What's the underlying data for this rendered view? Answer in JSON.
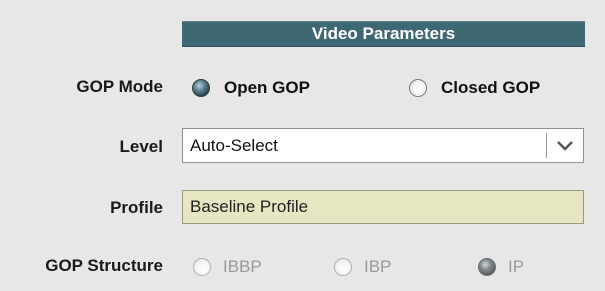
{
  "section": {
    "title": "Video Parameters"
  },
  "gop_mode": {
    "label": "GOP Mode",
    "options": [
      {
        "label": "Open GOP",
        "selected": true
      },
      {
        "label": "Closed GOP",
        "selected": false
      }
    ]
  },
  "level": {
    "label": "Level",
    "value": "Auto-Select"
  },
  "profile": {
    "label": "Profile",
    "value": "Baseline Profile"
  },
  "gop_structure": {
    "label": "GOP Structure",
    "options": [
      {
        "label": "IBBP",
        "selected": false
      },
      {
        "label": "IBP",
        "selected": false
      },
      {
        "label": "IP",
        "selected": true
      }
    ]
  },
  "colors": {
    "header_bg": "#3e6874",
    "profile_field_bg": "#e6e6c2",
    "panel_bg": "#e7e7e7"
  },
  "icons": {
    "dropdown": "chevron-down-icon",
    "radio_on": "radio-selected-icon",
    "radio_off": "radio-unselected-icon"
  }
}
